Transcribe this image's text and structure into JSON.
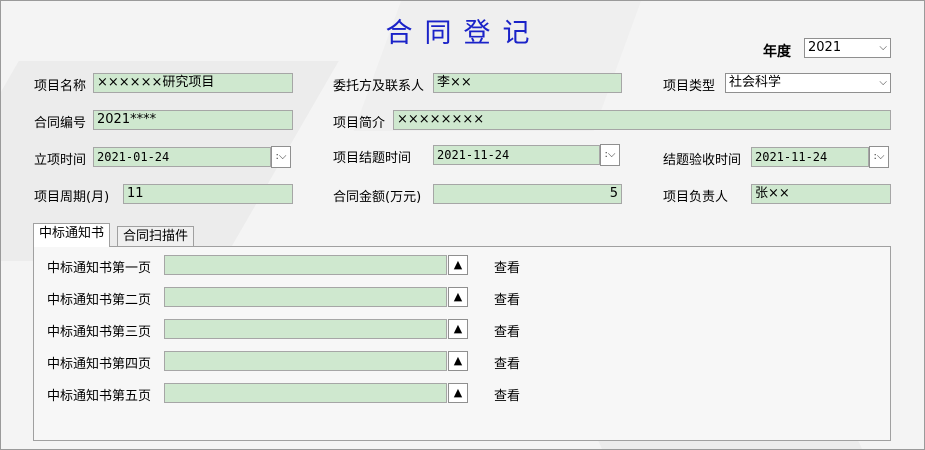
{
  "title": "合同登记",
  "year": {
    "label": "年度",
    "value": "2021"
  },
  "fields": {
    "project_name": {
      "label": "项目名称",
      "value": "××××××研究项目"
    },
    "client": {
      "label": "委托方及联系人",
      "value": "李××"
    },
    "project_type": {
      "label": "项目类型",
      "value": "社会科学"
    },
    "contract_no": {
      "label": "合同编号",
      "value": "2021****"
    },
    "project_intro": {
      "label": "项目简介",
      "value": "××××××××"
    },
    "start_date": {
      "label": "立项时间",
      "value": "2021-01-24"
    },
    "end_date": {
      "label": "项目结题时间",
      "value": "2021-11-24"
    },
    "acceptance_date": {
      "label": "结题验收时间",
      "value": "2021-11-24"
    },
    "period": {
      "label": "项目周期(月)",
      "value": "11"
    },
    "amount": {
      "label": "合同金额(万元)",
      "value": "5"
    },
    "manager": {
      "label": "项目负责人",
      "value": "张××"
    }
  },
  "tabs": [
    "中标通知书",
    "合同扫描件"
  ],
  "notices": [
    {
      "label": "中标通知书第一页",
      "value": "",
      "view": "查看"
    },
    {
      "label": "中标通知书第二页",
      "value": "",
      "view": "查看"
    },
    {
      "label": "中标通知书第三页",
      "value": "",
      "view": "查看"
    },
    {
      "label": "中标通知书第四页",
      "value": "",
      "view": "查看"
    },
    {
      "label": "中标通知书第五页",
      "value": "",
      "view": "查看"
    }
  ],
  "icons": {
    "dropdown": "chevron-down-icon",
    "datetime": "datetime-picker-icon",
    "upload": "upload-triangle-icon"
  },
  "colors": {
    "title": "#1a22c8",
    "field_bg": "#cfe8cf"
  }
}
